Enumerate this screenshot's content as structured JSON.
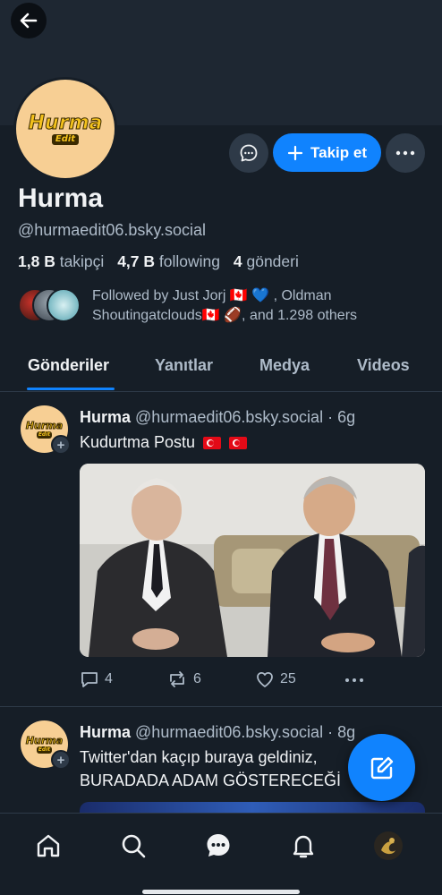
{
  "colors": {
    "accent": "#1083fe",
    "background": "#161e27",
    "banner": "#1e2732",
    "muted_text": "#aebbc9"
  },
  "profile": {
    "avatar_logo": "Hurma",
    "avatar_logo_sub": "Edit",
    "display_name": "Hurma",
    "handle": "@hurmaedit06.bsky.social",
    "follow_label": "Takip et",
    "stats": {
      "followers_count": "1,8 B",
      "followers_label": "takipçi",
      "following_count": "4,7 B",
      "following_label": "following",
      "posts_count": "4",
      "posts_label": "gönderi"
    },
    "followed_by": "Followed by Just Jorj 🇨🇦 💙 , Oldman Shoutingatclouds🇨🇦 🏈, and 1.298 others"
  },
  "tabs": [
    {
      "label": "Gönderiler",
      "active": true
    },
    {
      "label": "Yanıtlar",
      "active": false
    },
    {
      "label": "Medya",
      "active": false
    },
    {
      "label": "Videos",
      "active": false
    }
  ],
  "posts": [
    {
      "author": "Hurma",
      "handle": "@hurmaedit06.bsky.social",
      "time": "· 6g",
      "text": "Kudurtma Postu",
      "replies": "4",
      "reposts": "6",
      "likes": "25"
    },
    {
      "author": "Hurma",
      "handle": "@hurmaedit06.bsky.social",
      "time": "· 8g",
      "line1": "Twitter'dan kaçıp buraya geldiniz,",
      "line2": "BURADADA ADAM GÖSTERECEĞİ"
    }
  ],
  "icons": {
    "back": "arrow-left-icon",
    "message": "chat-bubble-icon",
    "follow": "plus-icon",
    "more": "ellipsis-icon",
    "reply": "comment-icon",
    "repost": "repost-icon",
    "like": "heart-icon",
    "compose": "pencil-icon",
    "nav": [
      "home-icon",
      "search-icon",
      "chat-icon",
      "bell-icon",
      "profile-avatar"
    ]
  }
}
